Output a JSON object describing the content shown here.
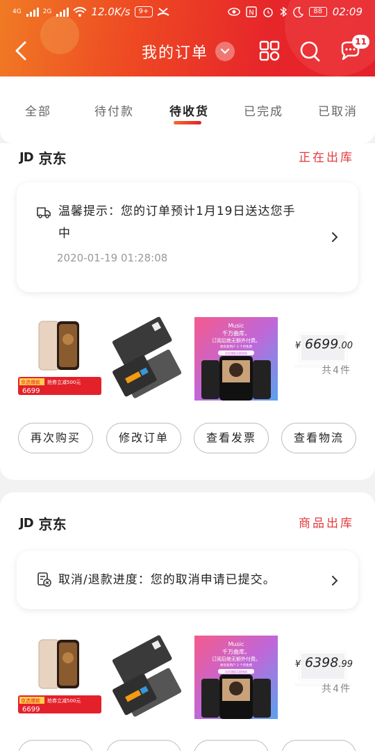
{
  "statusbar": {
    "net1": "4G",
    "net2": "2G",
    "speed": "12.0K/s",
    "notif_pill": "9+",
    "battery": "88",
    "time": "02:09"
  },
  "navbar": {
    "title": "我的订单",
    "message_count": "11"
  },
  "tabs": [
    {
      "label": "全部"
    },
    {
      "label": "待付款"
    },
    {
      "label": "待收货"
    },
    {
      "label": "已完成"
    },
    {
      "label": "已取消"
    }
  ],
  "orders": [
    {
      "shop_logo": "JD",
      "shop_name": "京东",
      "status": "正在出库",
      "tip_line1": "温馨提示：您的订单预计1月19日送达您手",
      "tip_line2": "中",
      "tip_time": "2020-01-19 01:28:08",
      "promo_label": "京选爆款",
      "promo_text": "抢券立减500元",
      "promo_price": "6699",
      "price_symbol": "¥",
      "price_int": "6699",
      "price_dec": ".00",
      "count": "共4件",
      "buttons": [
        "再次购买",
        "修改订单",
        "查看发票",
        "查看物流"
      ]
    },
    {
      "shop_logo": "JD",
      "shop_name": "京东",
      "status": "商品出库",
      "tip_line1": "取消/退款进度：您的取消申请已提交。",
      "promo_label": "京选爆款",
      "promo_text": "抢券立减500元",
      "promo_price": "6699",
      "price_symbol": "¥",
      "price_int": "6398",
      "price_dec": ".99",
      "count": "共4件"
    }
  ],
  "music_ad": {
    "brand": "Music",
    "line1": "千万曲库，",
    "line2": "订阅后绝无额外付费。",
    "line3": "更有新用户 3 个月免费",
    "cta": "点击领取立即体验"
  },
  "colors": {
    "accent": "#e4212a",
    "status_red": "#e4393c",
    "header_orange": "#f07b24"
  }
}
